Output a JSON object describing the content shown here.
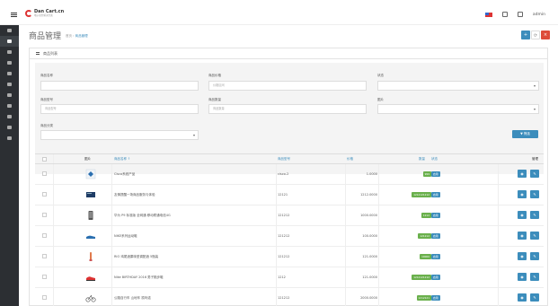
{
  "brand": {
    "name": "Dan Cart.cn",
    "tagline": "电子商务解决方案"
  },
  "topbar": {
    "user": "admin",
    "lang_icon": "flag-icon",
    "colors": {
      "accent": "#3c8dbc",
      "danger": "#dd4b39",
      "success": "#00a65a"
    }
  },
  "page": {
    "title": "商品管理",
    "crumbs": [
      "首页",
      "商品管理"
    ],
    "head_buttons": [
      "+",
      "⟳",
      "×"
    ]
  },
  "panel": {
    "title": "商品列表"
  },
  "filter": {
    "fields": [
      {
        "label": "商品名称",
        "placeholder": ""
      },
      {
        "label": "商品价格",
        "placeholder": "价格区间"
      },
      {
        "label": "状态",
        "placeholder": ""
      },
      {
        "label": "商品型号",
        "placeholder": "商品型号"
      },
      {
        "label": "商品数量",
        "placeholder": "商品数量"
      },
      {
        "label": "图片",
        "placeholder": ""
      },
      {
        "label": "商品分类",
        "placeholder": ""
      }
    ],
    "search_label": "▼ 筛选"
  },
  "table": {
    "headers": [
      "图片",
      "商品名称 ↑",
      "商品型号",
      "价格",
      "数量",
      "状态",
      "管理"
    ],
    "rows": [
      {
        "name": "Cisco系统产品",
        "model": "cisco-2",
        "price": "1.0000",
        "qty": "999",
        "status": "启用",
        "qty_color": "#6ab04c"
      },
      {
        "name": "友情提醒一场商品服务与体验",
        "model": "12121",
        "price": "1212.0000",
        "qty": "1212121212",
        "status": "启用",
        "qty_color": "#6ab04c"
      },
      {
        "name": "华为 P9 标准版 全网通 移动联通电信4G",
        "model": "121212",
        "price": "1000.0000",
        "qty": "1212",
        "status": "启用",
        "qty_color": "#6ab04c"
      },
      {
        "name": "NIKE系列运动鞋",
        "model": "121212",
        "price": "100.0000",
        "qty": "121212",
        "status": "启用",
        "qty_color": "#6ab04c"
      },
      {
        "name": "RIO 鸡尾酒果味型调配酒 5瓶装",
        "model": "121212",
        "price": "121.0000",
        "qty": "10000",
        "status": "启用",
        "qty_color": "#6ab04c"
      },
      {
        "name": "Nike BIRTHDAY 2016 男子跑步鞋",
        "model": "1212",
        "price": "121.0000",
        "qty": "1212121212",
        "status": "启用",
        "qty_color": "#6ab04c"
      },
      {
        "name": "公路自行车 山地车 禧玛诺",
        "model": "121212",
        "price": "2000.0000",
        "qty": "1212121",
        "status": "启用",
        "qty_color": "#6ab04c"
      }
    ]
  }
}
